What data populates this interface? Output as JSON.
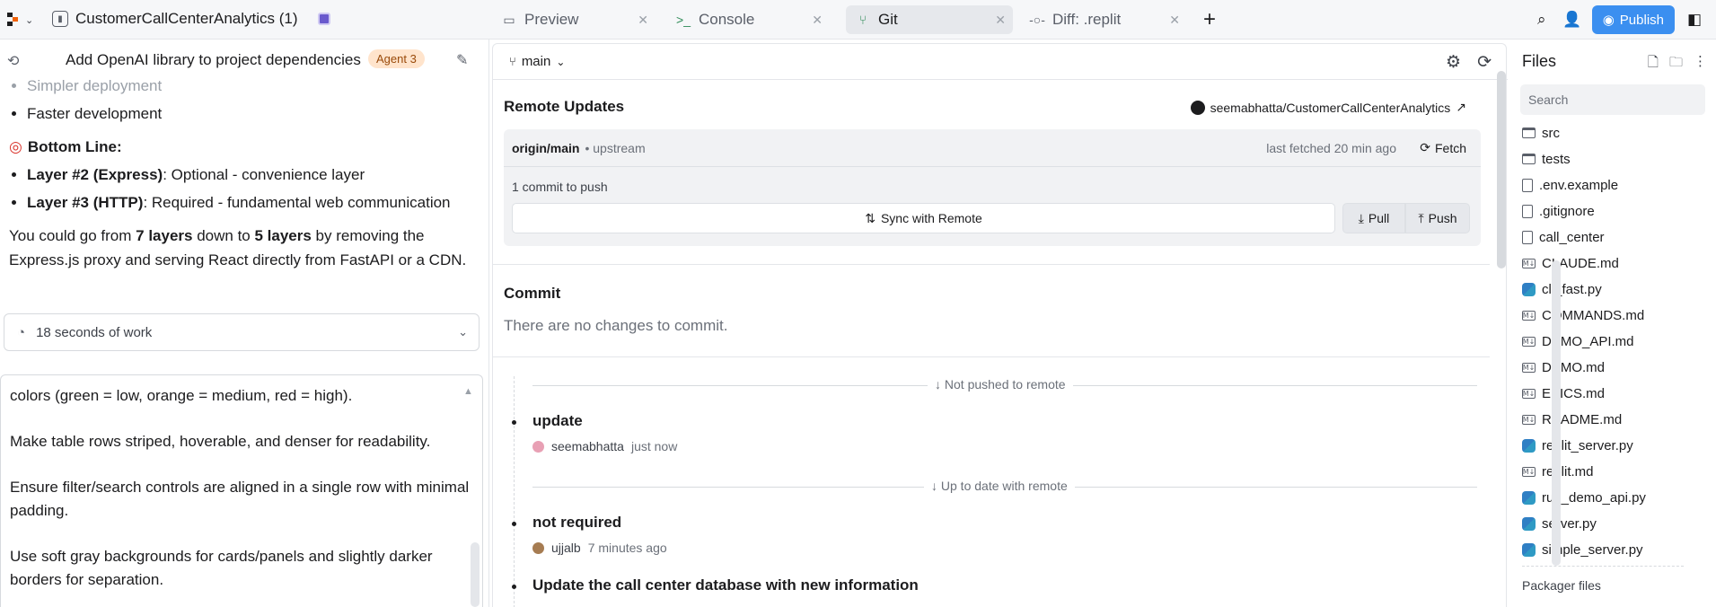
{
  "topbar": {
    "project_name": "CustomerCallCenterAnalytics (1)",
    "tabs": [
      {
        "label": "Preview",
        "icon": "monitor-icon",
        "active": false
      },
      {
        "label": "Console",
        "icon": "terminal-icon",
        "active": false
      },
      {
        "label": "Git",
        "icon": "git-branch-icon",
        "active": true
      },
      {
        "label": "Diff: .replit",
        "icon": "git-commit-icon",
        "active": false
      }
    ],
    "publish_label": "Publish",
    "accent_color": "#3b8ff0"
  },
  "chat": {
    "title": "Add OpenAI library to project dependencies",
    "agent_badge": "Agent 3",
    "bullets_top": [
      "Simpler deployment",
      "Faster development"
    ],
    "bottom_line_label": "Bottom Line:",
    "layer_items": [
      {
        "bold": "Layer #2 (Express)",
        "rest": ": Optional - convenience layer"
      },
      {
        "bold": "Layer #3 (HTTP)",
        "rest": ": Required - fundamental web communication"
      }
    ],
    "summary": {
      "pre": "You could go from ",
      "b1": "7 layers",
      "mid": " down to ",
      "b2": "5 layers",
      "post": " by removing the Express.js proxy and serving React directly from FastAPI or a CDN."
    },
    "work_label": "18 seconds of work",
    "input_paragraphs": [
      "colors (green = low, orange = medium, red = high).",
      "Make table rows striped, hoverable, and denser for readability.",
      "Ensure filter/search controls are aligned in a single row with minimal padding.",
      "Use soft gray backgrounds for cards/panels and slightly darker borders for separation."
    ]
  },
  "git": {
    "branch": "main",
    "remote_updates_title": "Remote Updates",
    "repo": "seemabhatta/CustomerCallCenterAnalytics",
    "remote_name": "origin/main",
    "upstream_label": "upstream",
    "last_fetched": "last fetched 20 min ago",
    "fetch_label": "Fetch",
    "commits_to_push": "1 commit to push",
    "sync_label": "Sync with Remote",
    "pull_label": "Pull",
    "push_label": "Push",
    "commit_title": "Commit",
    "no_changes": "There are no changes to commit.",
    "not_pushed_label": "Not pushed to remote",
    "up_to_date_label": "Up to date with remote",
    "commits": [
      {
        "message": "update",
        "author": "seemabhatta",
        "time": "just now"
      },
      {
        "message": "not required",
        "author": "ujjalb",
        "time": "7 minutes ago"
      },
      {
        "message": "Update the call center database with new information",
        "author": "",
        "time": ""
      }
    ]
  },
  "files": {
    "title": "Files",
    "search_placeholder": "Search",
    "items": [
      {
        "name": "src",
        "type": "folder"
      },
      {
        "name": "tests",
        "type": "folder"
      },
      {
        "name": ".env.example",
        "type": "file"
      },
      {
        "name": ".gitignore",
        "type": "file"
      },
      {
        "name": "call_center",
        "type": "file"
      },
      {
        "name": "CLAUDE.md",
        "type": "md"
      },
      {
        "name": "cli_fast.py",
        "type": "py"
      },
      {
        "name": "COMMANDS.md",
        "type": "md"
      },
      {
        "name": "DEMO_API.md",
        "type": "md"
      },
      {
        "name": "DEMO.md",
        "type": "md"
      },
      {
        "name": "EPICS.md",
        "type": "md"
      },
      {
        "name": "README.md",
        "type": "md"
      },
      {
        "name": "replit_server.py",
        "type": "py"
      },
      {
        "name": "replit.md",
        "type": "md"
      },
      {
        "name": "run_demo_api.py",
        "type": "py"
      },
      {
        "name": "server.py",
        "type": "py"
      },
      {
        "name": "simple_server.py",
        "type": "py"
      }
    ],
    "packager_label": "Packager files"
  }
}
